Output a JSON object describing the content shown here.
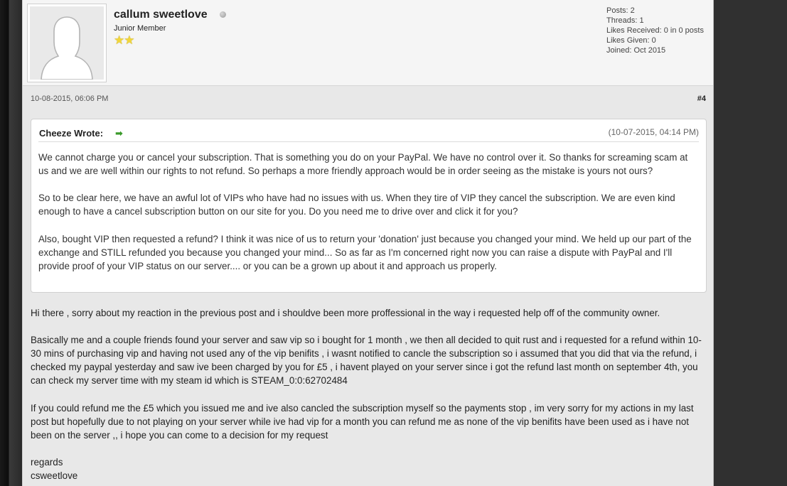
{
  "author": {
    "username": "callum sweetlove",
    "user_title": "Junior Member",
    "online_status_icon": "offline-dot-icon",
    "rank_stars": 2,
    "stats": [
      "Posts: 2",
      "Threads: 1",
      "Likes Received: 0 in 0 posts",
      "Likes Given: 0",
      "Joined: Oct 2015"
    ]
  },
  "post": {
    "date": "10-08-2015, 06:06 PM",
    "number": "#4"
  },
  "quote": {
    "author": "Cheeze Wrote:",
    "arrow_icon": "go-to-post-arrow-icon",
    "date": "(10-07-2015, 04:14 PM)",
    "paragraphs": [
      "We cannot charge you or cancel your subscription. That is something you do on your PayPal. We have no control over it. So thanks for screaming scam at us and we are well within our rights to not refund. So perhaps a more friendly approach would be in order seeing as the mistake is yours not ours?",
      "So to be clear here, we have an awful lot of VIPs who have had no issues with us. When they tire of VIP they cancel the subscription. We are even kind enough to have a cancel subscription button on our site for you. Do you need me to drive over and click it for you?",
      "Also, bought VIP then requested a refund? I think it was nice of us to return your 'donation' just because you changed your mind. We held up our part of the exchange and STILL refunded you because you changed your mind... So as far as I'm concerned right now you can raise a dispute with PayPal and I'll provide proof of your VIP status on our server.... or you can be a grown up about it and approach us properly."
    ]
  },
  "message": {
    "paragraphs": [
      "Hi there , sorry about my reaction in the previous post and i shouldve been more proffessional in the way i requested help off of the community owner.",
      "Basically me and a couple friends found your server and saw vip so i bought for 1 month , we then all decided to quit rust and i requested for a refund within 10-30 mins of purchasing vip and having not used any of the vip benifits , i wasnt notified to cancle the subscription so i assumed that you did that via the refund, i checked my paypal yesterday and saw ive been charged by you for £5 , i havent played on your server since i got the refund last month on september 4th, you can check my server time with my steam id which is STEAM_0:0:62702484",
      "If you could refund me the £5 which you issued me and ive also cancled the subscription myself so the payments stop , im very sorry for my actions in my last post but hopefully due to not playing on your server while ive had vip for a month you can refund me as none of the vip benifits have been used as i have not been on the server ,, i hope you can come to a decision for my request"
    ],
    "signoff": [
      "regards",
      "csweetlove"
    ]
  }
}
